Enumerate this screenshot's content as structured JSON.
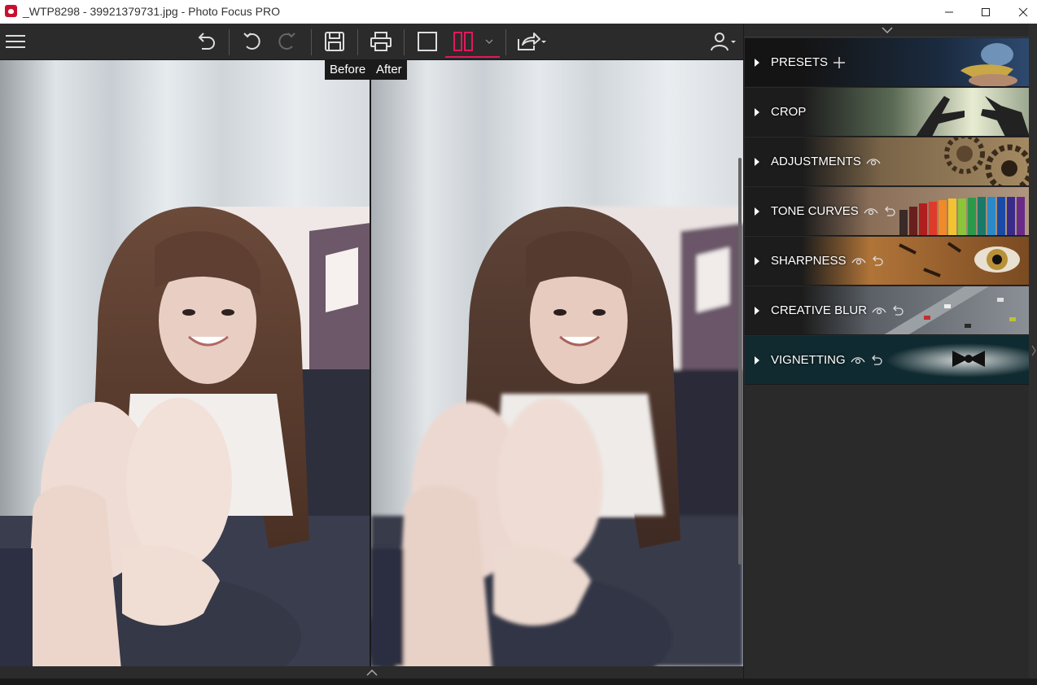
{
  "window": {
    "title": "_WTP8298 - 39921379731.jpg - Photo Focus PRO",
    "minimize": "—",
    "maximize": "☐",
    "close": "✕"
  },
  "toolbar": {
    "icons": [
      "menu-icon",
      "undo-all-icon",
      "undo-icon",
      "redo-icon",
      "save-icon",
      "print-icon",
      "single-view-icon",
      "split-view-icon",
      "split-dropdown-icon",
      "share-icon",
      "user-icon"
    ],
    "accent_color": "#e0195a"
  },
  "canvas": {
    "before_label": "Before",
    "after_label": "After"
  },
  "panel": {
    "items": [
      {
        "label": "PRESETS",
        "icons": [
          "plus-icon"
        ],
        "theme": "magic-lamp"
      },
      {
        "label": "CROP",
        "icons": [],
        "theme": "hands-frame"
      },
      {
        "label": "ADJUSTMENTS",
        "icons": [
          "eye-icon"
        ],
        "theme": "gears"
      },
      {
        "label": "TONE CURVES",
        "icons": [
          "eye-icon",
          "reset-icon"
        ],
        "theme": "colored-pencils"
      },
      {
        "label": "SHARPNESS",
        "icons": [
          "eye-icon",
          "reset-icon"
        ],
        "theme": "tiger-eye"
      },
      {
        "label": "CREATIVE BLUR",
        "icons": [
          "eye-icon",
          "reset-icon"
        ],
        "theme": "city-street"
      },
      {
        "label": "VIGNETTING",
        "icons": [
          "eye-icon",
          "reset-icon"
        ],
        "theme": "bow-tie"
      }
    ]
  }
}
